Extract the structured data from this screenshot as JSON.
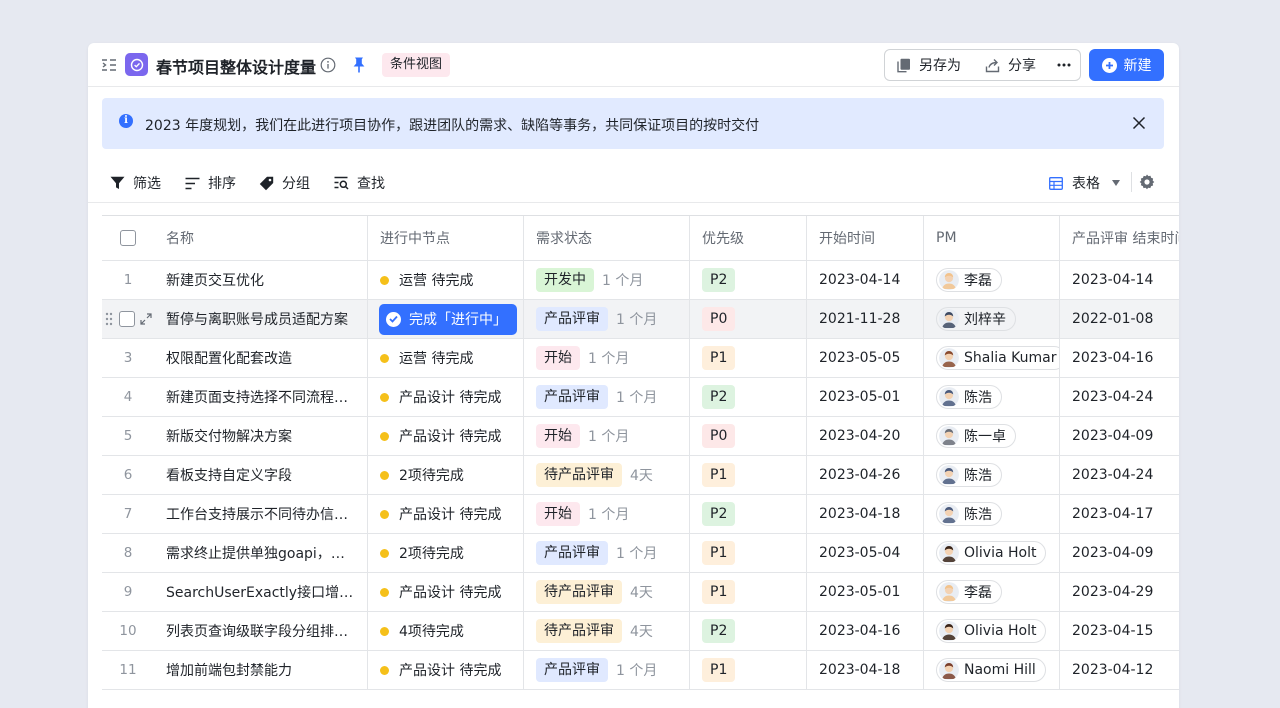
{
  "header": {
    "title": "春节项目整体设计度量",
    "view_badge": "条件视图",
    "save_as": "另存为",
    "share": "分享",
    "new": "新建"
  },
  "notice": {
    "text": "2023 年度规划，我们在此进行项目协作，跟进团队的需求、缺陷等事务，共同保证项目的按时交付"
  },
  "toolbar": {
    "filter": "筛选",
    "sort": "排序",
    "group": "分组",
    "find": "查找",
    "view": "表格"
  },
  "table": {
    "columns": {
      "name": "名称",
      "node": "进行中节点",
      "status": "需求状态",
      "priority": "优先级",
      "start": "开始时间",
      "pm": "PM",
      "end": "产品评审 结束时间"
    },
    "rows": [
      {
        "idx": "1",
        "name": "新建页交互优化",
        "node": "运营 待完成",
        "status": "开发中",
        "status_kind": "dev",
        "duration": "1 个月",
        "priority": "P2",
        "start": "2023-04-14",
        "pm": "李磊",
        "avatar_color": "#f2c28b",
        "end": "2023-04-14"
      },
      {
        "idx": "2",
        "name": "暂停与离职账号成员适配方案",
        "node": "完成「进行中」",
        "status": "产品评审",
        "status_kind": "review",
        "duration": "1 个月",
        "priority": "P0",
        "start": "2021-11-28",
        "pm": "刘梓辛",
        "avatar_color": "#3d4a63",
        "end": "2022-01-08"
      },
      {
        "idx": "3",
        "name": "权限配置化配套改造",
        "node": "运营 待完成",
        "status": "开始",
        "status_kind": "start",
        "duration": "1 个月",
        "priority": "P1",
        "start": "2023-05-05",
        "pm": "Shalia Kumar",
        "avatar_color": "#8a4b2e",
        "end": "2023-04-16"
      },
      {
        "idx": "4",
        "name": "新建页面支持选择不同流程类型",
        "node": "产品设计 待完成",
        "status": "产品评审",
        "status_kind": "review",
        "duration": "1 个月",
        "priority": "P2",
        "start": "2023-05-01",
        "pm": "陈浩",
        "avatar_color": "#4a5a7c",
        "end": "2023-04-24"
      },
      {
        "idx": "5",
        "name": "新版交付物解决方案",
        "node": "产品设计 待完成",
        "status": "开始",
        "status_kind": "start",
        "duration": "1 个月",
        "priority": "P0",
        "start": "2023-04-20",
        "pm": "陈一卓",
        "avatar_color": "#6b6f78",
        "end": "2023-04-09"
      },
      {
        "idx": "6",
        "name": "看板支持自定义字段",
        "node": "2项待完成",
        "status": "待产品评审",
        "status_kind": "wait",
        "duration": "4天",
        "priority": "P1",
        "start": "2023-04-26",
        "pm": "陈浩",
        "avatar_color": "#4a5a7c",
        "end": "2023-04-24"
      },
      {
        "idx": "7",
        "name": "工作台支持展示不同待办信息…",
        "node": "产品设计 待完成",
        "status": "开始",
        "status_kind": "start",
        "duration": "1 个月",
        "priority": "P2",
        "start": "2023-04-18",
        "pm": "陈浩",
        "avatar_color": "#4a5a7c",
        "end": "2023-04-17"
      },
      {
        "idx": "8",
        "name": "需求终止提供单独goapi，前…",
        "node": "2项待完成",
        "status": "产品评审",
        "status_kind": "review",
        "duration": "1 个月",
        "priority": "P1",
        "start": "2023-05-04",
        "pm": "Olivia Holt",
        "avatar_color": "#3a2418",
        "end": "2023-04-09"
      },
      {
        "idx": "9",
        "name": "SearchUserExactly接口增加…",
        "node": "产品设计 待完成",
        "status": "待产品评审",
        "status_kind": "wait",
        "duration": "4天",
        "priority": "P1",
        "start": "2023-05-01",
        "pm": "李磊",
        "avatar_color": "#f2c28b",
        "end": "2023-04-29"
      },
      {
        "idx": "10",
        "name": "列表页查询级联字段分组排序…",
        "node": "4项待完成",
        "status": "待产品评审",
        "status_kind": "wait",
        "duration": "4天",
        "priority": "P2",
        "start": "2023-04-16",
        "pm": "Olivia Holt",
        "avatar_color": "#3a2418",
        "end": "2023-04-15"
      },
      {
        "idx": "11",
        "name": "增加前端包封禁能力",
        "node": "产品设计 待完成",
        "status": "产品评审",
        "status_kind": "review",
        "duration": "1 个月",
        "priority": "P1",
        "start": "2023-04-18",
        "pm": "Naomi Hill",
        "avatar_color": "#7a3e2a",
        "end": "2023-04-12"
      }
    ]
  }
}
